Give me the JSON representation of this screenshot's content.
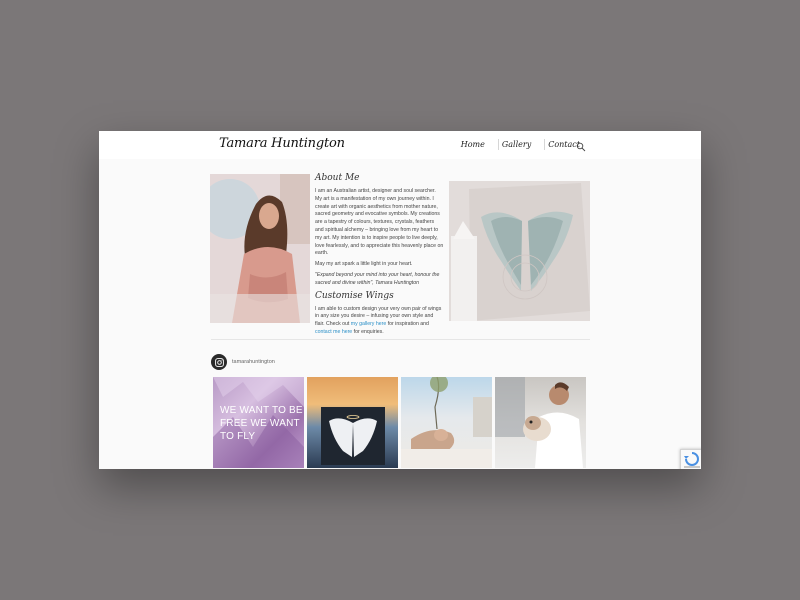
{
  "header": {
    "logo": "Tamara Huntington",
    "menu": [
      "Home",
      "Gallery",
      "Contact"
    ],
    "search_icon": "search-icon"
  },
  "about": {
    "heading": "About Me",
    "p1": "I am an Australian artist, designer and soul searcher. My art is a manifestation of my own journey within. I create art with organic aesthetics from mother nature, sacred geometry and evocative symbols. My creations are a tapestry of colours, textures, crystals, feathers and spiritual alchemy – bringing love from my heart to my art. My intention is to inspire people to live deeply, love fearlessly, and to appreciate this heavenly place on earth.",
    "p2": "May my art spark a little light in your heart.",
    "quote": "\"Expand beyond your mind into your heart, honour the sacred and divine within\", Tamara Huntington"
  },
  "custom": {
    "heading": "Customise Wings",
    "text_before": "I am able to custom design your very own pair of wings in any size you desire – infusing your own style and flair. Check out",
    "link_gallery": "my gallery here",
    "text_mid": "for inspiration and",
    "link_contact": "contact me here",
    "text_after": "for enquiries."
  },
  "instagram": {
    "icon": "instagram-icon",
    "handle": "tamarahuntington",
    "tile_text": "WE WANT TO BE FREE WE WANT TO FLY"
  }
}
